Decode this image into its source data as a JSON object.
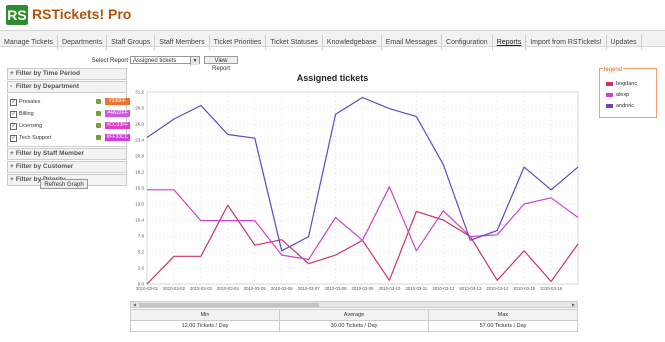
{
  "app": {
    "logo_text": "RS",
    "title": "RSTickets! Pro"
  },
  "nav": {
    "items": [
      {
        "label": "Manage Tickets"
      },
      {
        "label": "Departments"
      },
      {
        "label": "Staff Groups"
      },
      {
        "label": "Staff Members"
      },
      {
        "label": "Ticket Priorities"
      },
      {
        "label": "Ticket Statuses"
      },
      {
        "label": "Knowledgebase"
      },
      {
        "label": "Email Messages"
      },
      {
        "label": "Configuration"
      },
      {
        "label": "Reports",
        "active": true
      },
      {
        "label": "Import from RSTickets!"
      },
      {
        "label": "Updates"
      }
    ]
  },
  "report": {
    "select_label": "Select Report",
    "selected": "Assigned tickets",
    "view_button": "View Report"
  },
  "filters": {
    "time_period": "Filter by Time Period",
    "department": "Filter by Department",
    "staff_member": "Filter by Staff Member",
    "customer": "Filter by Customer",
    "priority": "Filter by Priority",
    "refresh_button": "Refresh Graph",
    "departments": [
      {
        "name": "Presales",
        "color_label": "#336FF",
        "color": "#f07030",
        "checked": true
      },
      {
        "name": "Billing",
        "color_label": "#4A22FF",
        "color": "#d055e0",
        "checked": true
      },
      {
        "name": "Licensing",
        "color_label": "#CC33FF",
        "color": "#e040c8",
        "checked": true
      },
      {
        "name": "Tech Support",
        "color_label": "#FF33CC",
        "color": "#d040e0",
        "checked": true
      }
    ]
  },
  "chart_data": {
    "type": "line",
    "title": "Assigned tickets",
    "x": [
      "2010-03-01",
      "2010-03-02",
      "2010-03-03",
      "2010-03-04",
      "2010-03-05",
      "2010-03-06",
      "2010-03-07",
      "2010-03-08",
      "2010-03-09",
      "2010-03-10",
      "2010-03-11",
      "2010-03-12",
      "2010-03-13",
      "2010-03-14",
      "2010-03-15",
      "2010-03-16"
    ],
    "y_ticks": [
      "0.0",
      "2.6",
      "5.2",
      "7.8",
      "10.4",
      "13.0",
      "15.6",
      "18.2",
      "20.8",
      "23.4",
      "26.0",
      "28.6",
      "31.2"
    ],
    "ylim": [
      0,
      31.2
    ],
    "series": [
      {
        "name": "bogdanc",
        "color": "#cc3366",
        "values": [
          0,
          4.5,
          4.5,
          12.8,
          6.3,
          7.2,
          3.3,
          4.7,
          7.1,
          0.6,
          11.8,
          10.4,
          7.7,
          0.6,
          5.4,
          0.4,
          6.5
        ]
      },
      {
        "name": "alexp",
        "color": "#cc44cc",
        "values": [
          15.3,
          15.3,
          10.3,
          10.3,
          10.3,
          4.7,
          4.0,
          10.8,
          7.1,
          15.8,
          5.4,
          11.9,
          7.7,
          8.0,
          13.0,
          14.0,
          10.8
        ]
      },
      {
        "name": "andreic",
        "color": "#6644cc",
        "values": [
          23.8,
          26.8,
          29.0,
          24.3,
          23.7,
          5.4,
          7.7,
          27.6,
          30.3,
          28.5,
          27.2,
          19.4,
          7.1,
          8.7,
          19.0,
          15.3,
          19.0
        ]
      }
    ],
    "legend": {
      "title": "legend",
      "placement": "top-right"
    }
  },
  "stats": {
    "headers": [
      "Min",
      "Average",
      "Max"
    ],
    "values": [
      "12.00 Tickets / Day",
      "30.00 Tickets / Day",
      "57.00 Tickets / Day"
    ]
  }
}
